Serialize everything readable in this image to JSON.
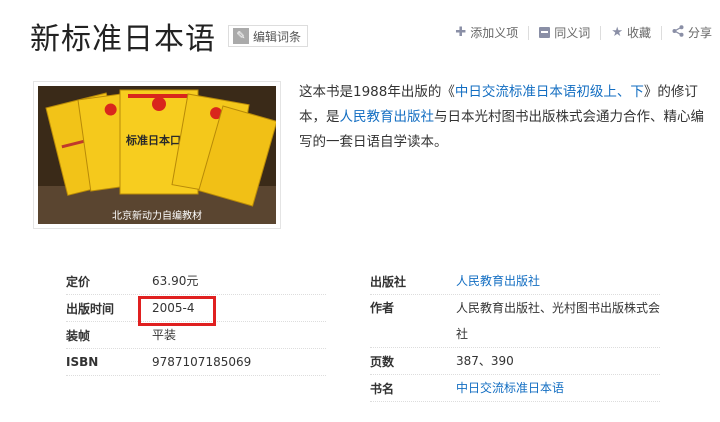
{
  "header": {
    "title": "新标准日本语",
    "edit_label": "编辑词条"
  },
  "actions": {
    "add_tag": "添加义项",
    "synonym": "同义词",
    "favorite": "收藏",
    "share": "分享"
  },
  "image": {
    "caption": "北京新动力自编教材",
    "book_title": "标准日本口语"
  },
  "summary": {
    "p1": "这本书是1988年出版的《",
    "link1": "中日交流标准日本语初级上、下",
    "p2": "》的修订本，是",
    "link2": "人民教育出版社",
    "p3": "与日本光村图书出版株式会通力合作、精心编写的一套日语自学读本。"
  },
  "info_left": [
    {
      "key": "定价",
      "value": "63.90元"
    },
    {
      "key": "出版时间",
      "value": "2005-4"
    },
    {
      "key": "装帧",
      "value": "平装"
    },
    {
      "key": "ISBN",
      "value": "9787107185069"
    }
  ],
  "info_right": [
    {
      "key": "出版社",
      "value": "人民教育出版社"
    },
    {
      "key": "作者",
      "value": "人民教育出版社、光村图书出版株式会社"
    },
    {
      "key": "页数",
      "value": "387、390"
    },
    {
      "key": "书名",
      "value": "中日交流标准日本语"
    }
  ],
  "colors": {
    "link": "#136ec2",
    "highlight": "#e02020",
    "book_yellow": "#f2c318"
  }
}
